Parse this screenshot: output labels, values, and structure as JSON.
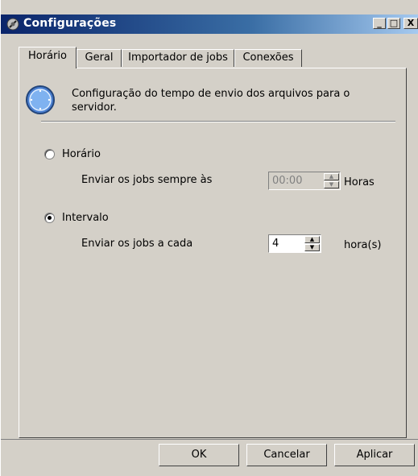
{
  "window": {
    "title": "Configurações",
    "minimize": "_",
    "maximize": "□",
    "close": "X"
  },
  "tabs": [
    {
      "label": "Horário",
      "active": true
    },
    {
      "label": "Geral",
      "active": false
    },
    {
      "label": "Importador de jobs",
      "active": false
    },
    {
      "label": "Conexões",
      "active": false
    }
  ],
  "panel": {
    "description": "Configuração do tempo de envio dos arquivos para o servidor.",
    "horario": {
      "label": "Horário",
      "selected": false,
      "send_label": "Enviar os jobs sempre às",
      "time_value": "00:00",
      "unit": "Horas"
    },
    "intervalo": {
      "label": "Intervalo",
      "selected": true,
      "send_label": "Enviar os jobs a cada",
      "value": "4",
      "unit": "hora(s)"
    }
  },
  "buttons": {
    "ok": "OK",
    "cancel": "Cancelar",
    "apply": "Aplicar"
  }
}
